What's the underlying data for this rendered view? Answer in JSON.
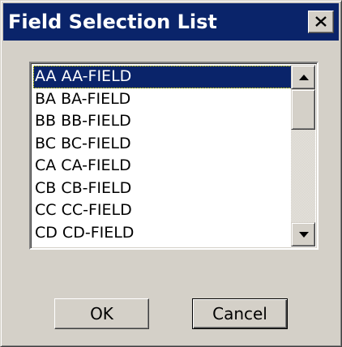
{
  "window": {
    "title": "Field Selection List",
    "close_icon": "close-x-icon"
  },
  "field_list": {
    "items": [
      "AA AA-FIELD",
      "BA BA-FIELD",
      "BB BB-FIELD",
      "BC BC-FIELD",
      "CA CA-FIELD",
      "CB CB-FIELD",
      "CC CC-FIELD",
      "CD CD-FIELD"
    ],
    "selected_index": 0,
    "scroll_up_icon": "scroll-up-arrow-icon",
    "scroll_down_icon": "scroll-down-arrow-icon"
  },
  "buttons": {
    "ok_label": "OK",
    "cancel_label": "Cancel"
  },
  "colors": {
    "titlebar": "#0a246a",
    "dialog_face": "#d4d0c8",
    "selection": "#0a246a"
  }
}
